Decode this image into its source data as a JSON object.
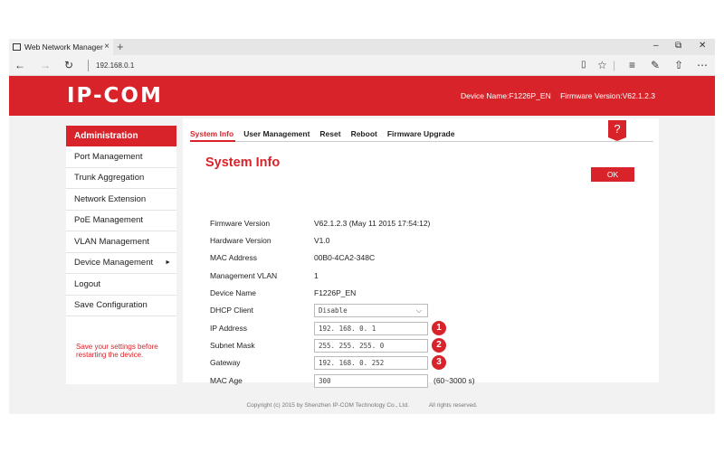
{
  "browser": {
    "tab_title": "Web Network Manager",
    "tab_close": "×",
    "new_tab": "+",
    "url": "192.168.0.1",
    "minimize": "–",
    "maximize": "⧉",
    "close": "✕"
  },
  "header": {
    "logo": "IP-COM",
    "device_name": "Device Name:F1226P_EN",
    "firmware_version": "Firmware Version:V62.1.2.3"
  },
  "sidebar": {
    "heading": "Administration",
    "items": [
      {
        "label": "Port Management"
      },
      {
        "label": "Trunk Aggregation"
      },
      {
        "label": "Network Extension"
      },
      {
        "label": "PoE Management"
      },
      {
        "label": "VLAN Management"
      },
      {
        "label": "Device Management",
        "arrow": "►"
      },
      {
        "label": "Logout"
      },
      {
        "label": "Save Configuration"
      }
    ],
    "note": "Save your settings before restarting the device."
  },
  "main": {
    "tabs": [
      "System Info",
      "User Management",
      "Reset",
      "Reboot",
      "Firmware Upgrade"
    ],
    "help": "?",
    "title": "System Info",
    "ok_label": "OK",
    "rows": {
      "firmware": {
        "label": "Firmware Version",
        "value": "V62.1.2.3 (May 11 2015 17:54:12)"
      },
      "hardware": {
        "label": "Hardware Version",
        "value": "V1.0"
      },
      "mac": {
        "label": "MAC Address",
        "value": "00B0-4CA2-348C"
      },
      "mgmt_vlan": {
        "label": "Management VLAN",
        "value": "1"
      },
      "device_name": {
        "label": "Device Name",
        "value": "F1226P_EN"
      },
      "dhcp": {
        "label": "DHCP Client",
        "value": "Disable",
        "chevron": "⌵"
      },
      "ip": {
        "label": "IP Address",
        "value": "192. 168. 0. 1",
        "badge": "1"
      },
      "subnet": {
        "label": "Subnet Mask",
        "value": "255. 255. 255. 0",
        "badge": "2"
      },
      "gateway": {
        "label": "Gateway",
        "value": "192. 168. 0. 252",
        "badge": "3"
      },
      "mac_age": {
        "label": "MAC Age",
        "value": "300",
        "suffix": "(60~3000 s)"
      }
    }
  },
  "footer": {
    "copyright": "Copyright (c) 2015 by Shenzhen IP-COM Technology Co., Ltd.",
    "rights": "All rights reserved."
  },
  "colors": {
    "brand_red": "#d8232a"
  }
}
